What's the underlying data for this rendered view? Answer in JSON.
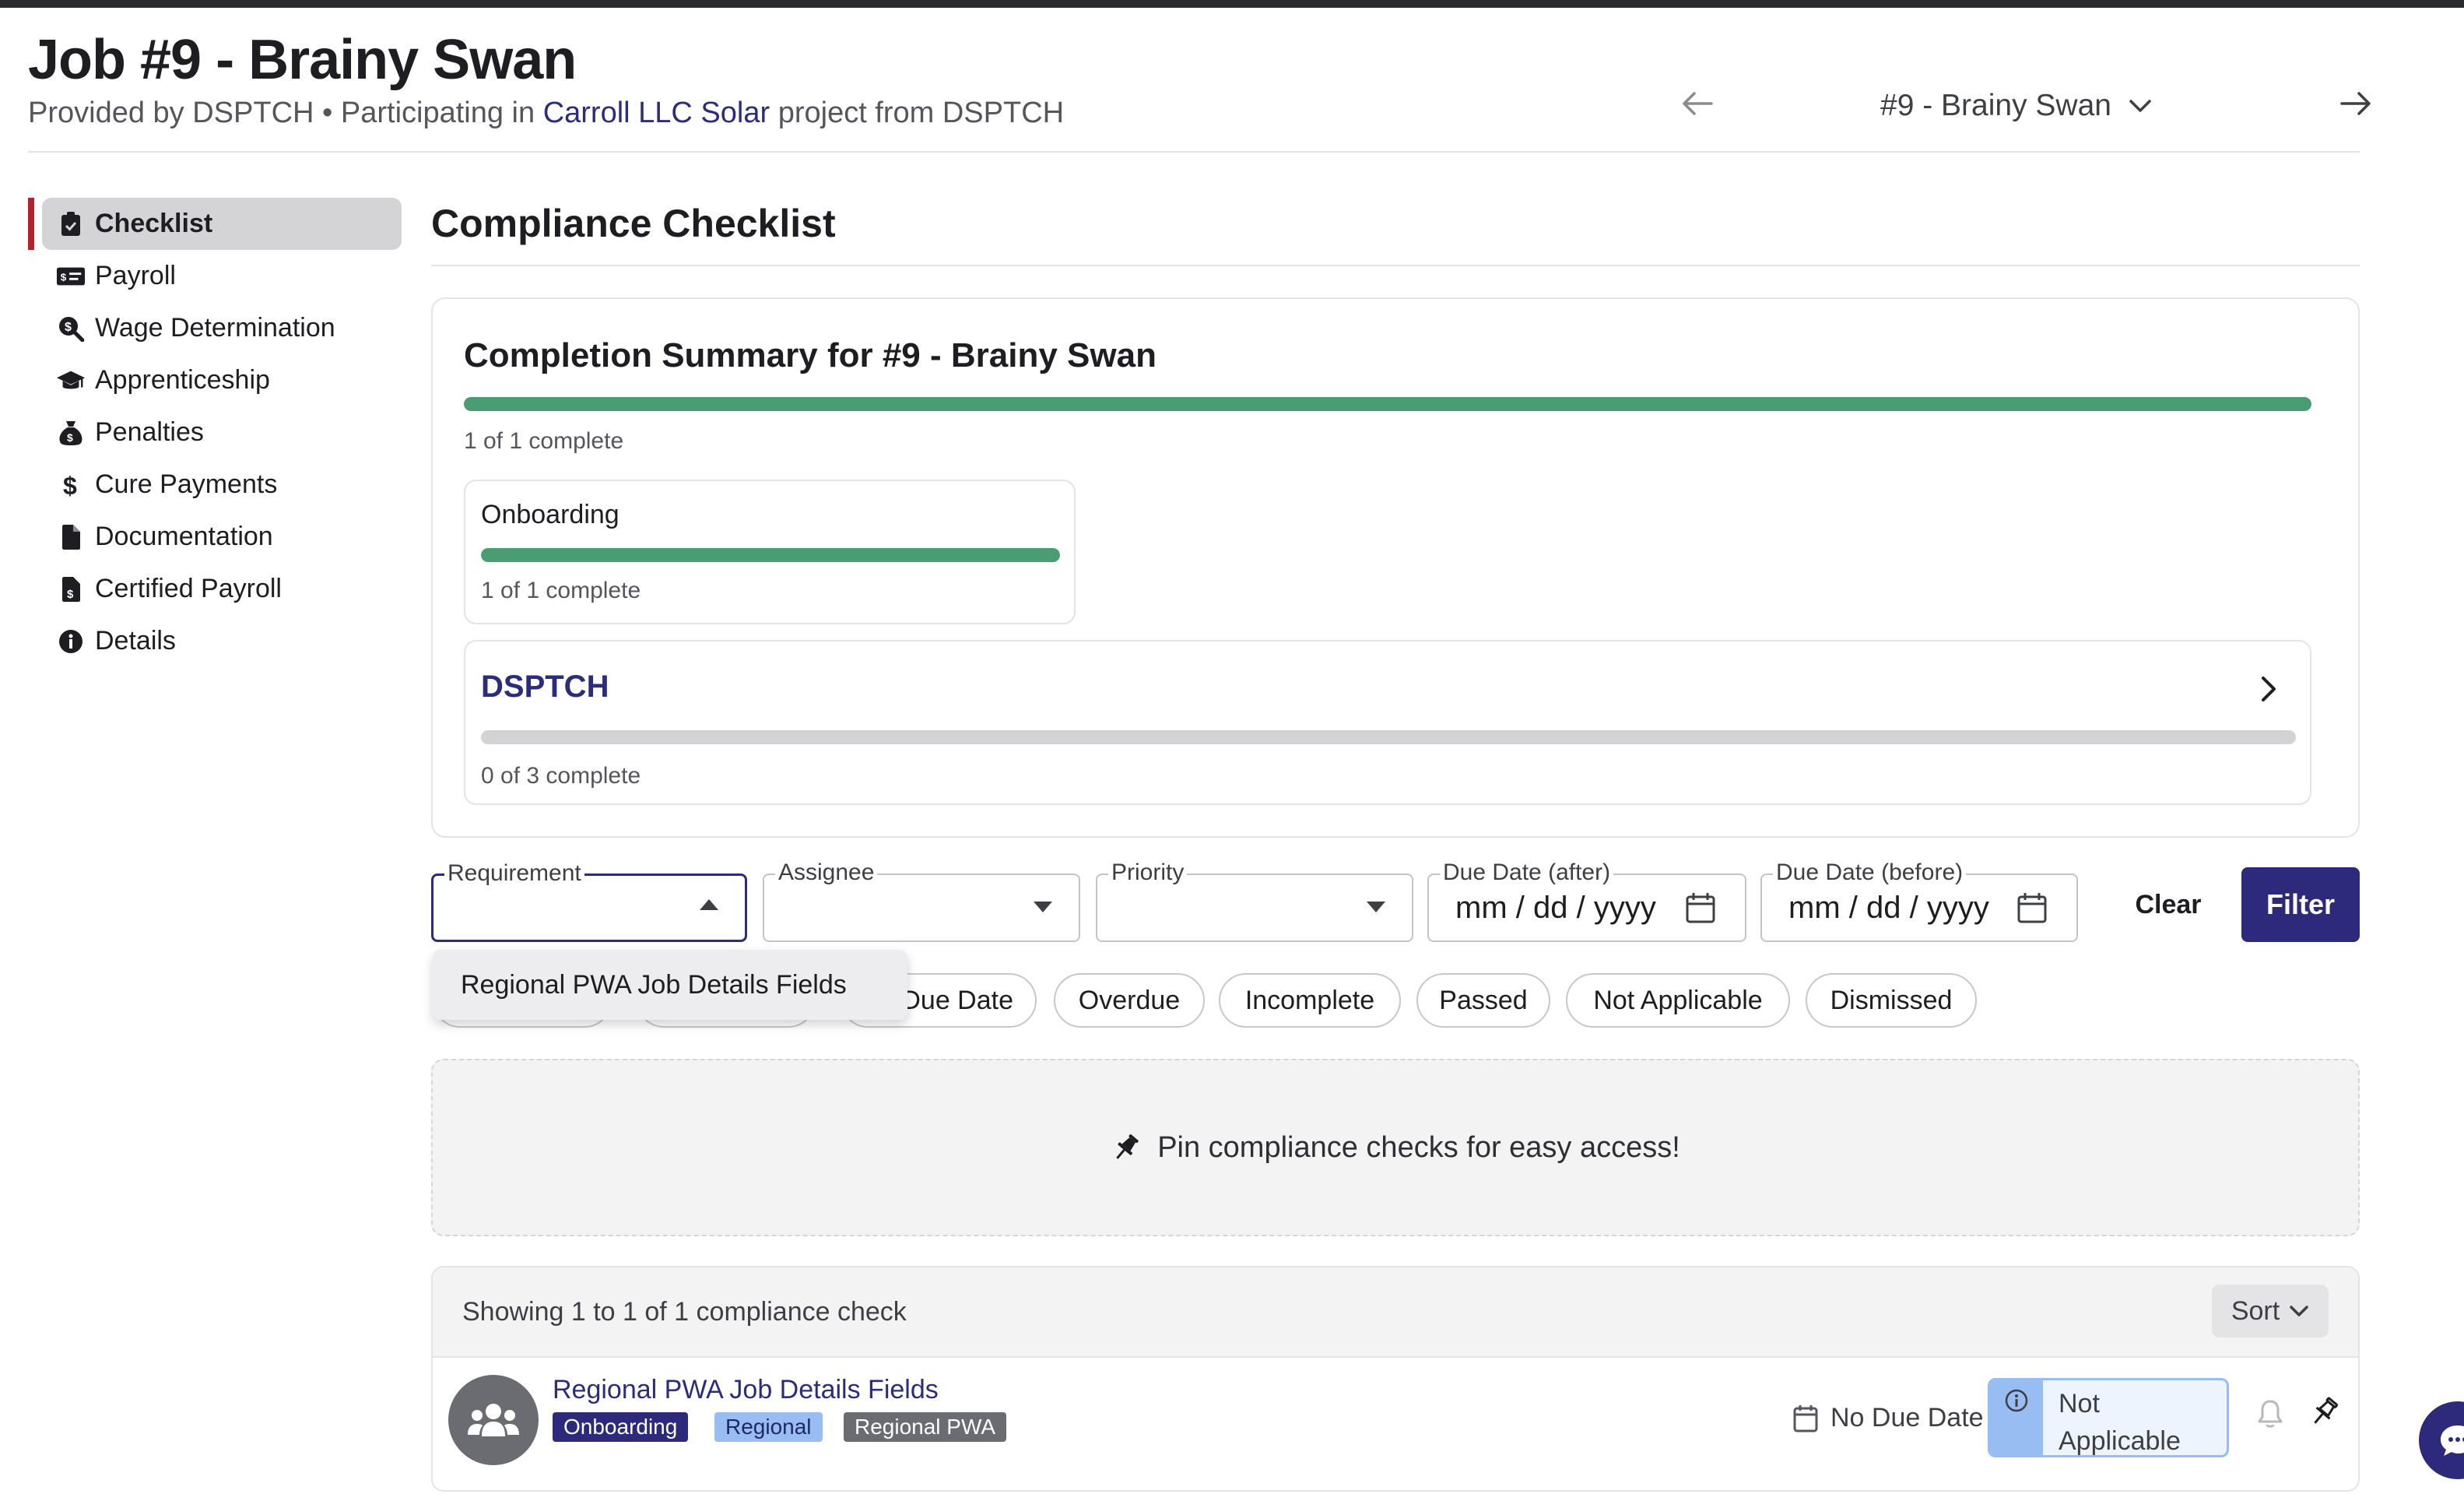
{
  "header": {
    "title": "Job #9 - Brainy Swan",
    "provided_prefix": "Provided by DSPTCH • Participating in ",
    "project_link": "Carroll LLC Solar",
    "provided_suffix": " project from DSPTCH",
    "job_selector": "#9 - Brainy Swan"
  },
  "sidebar": {
    "items": [
      {
        "label": "Checklist",
        "icon": "clipboard-check-icon",
        "active": true
      },
      {
        "label": "Payroll",
        "icon": "money-check-icon"
      },
      {
        "label": "Wage Determination",
        "icon": "search-dollar-icon"
      },
      {
        "label": "Apprenticeship",
        "icon": "graduation-cap-icon"
      },
      {
        "label": "Penalties",
        "icon": "money-bag-icon"
      },
      {
        "label": "Cure Payments",
        "icon": "dollar-icon"
      },
      {
        "label": "Documentation",
        "icon": "file-icon"
      },
      {
        "label": "Certified Payroll",
        "icon": "file-invoice-dollar-icon"
      },
      {
        "label": "Details",
        "icon": "info-circle-icon"
      }
    ]
  },
  "main": {
    "title": "Compliance Checklist",
    "summary": {
      "title": "Completion Summary for #9 - Brainy Swan",
      "overall_progress": 1.0,
      "overall_text": "1 of 1 complete",
      "groups": [
        {
          "name": "Onboarding",
          "progress": 1.0,
          "text": "1 of 1 complete"
        },
        {
          "name": "DSPTCH",
          "progress": 0.0,
          "text": "0 of 3 complete"
        }
      ]
    },
    "filters": {
      "requirement_label": "Requirement",
      "assignee_label": "Assignee",
      "priority_label": "Priority",
      "due_after_label": "Due Date (after)",
      "due_before_label": "Due Date (before)",
      "date_placeholder": "mm / dd / yyyy",
      "clear": "Clear",
      "filter": "Filter",
      "dropdown_option": "Regional PWA Job Details Fields",
      "chips": [
        "Due Date",
        "Overdue",
        "Incomplete",
        "Passed",
        "Not Applicable",
        "Dismissed"
      ]
    },
    "pin_banner": "Pin compliance checks for easy access!",
    "list": {
      "showing": "Showing 1 to 1 of 1 compliance check",
      "sort": "Sort",
      "rows": [
        {
          "title": "Regional PWA Job Details Fields",
          "badges": [
            "Onboarding",
            "Regional",
            "Regional PWA"
          ],
          "due": "No Due Date",
          "status": "Not Applicable"
        }
      ]
    }
  },
  "colors": {
    "brand": "#2d2a7c",
    "progress": "#4a9c72",
    "active_bar": "#b2232e",
    "status_blue": "#97bdf2"
  }
}
